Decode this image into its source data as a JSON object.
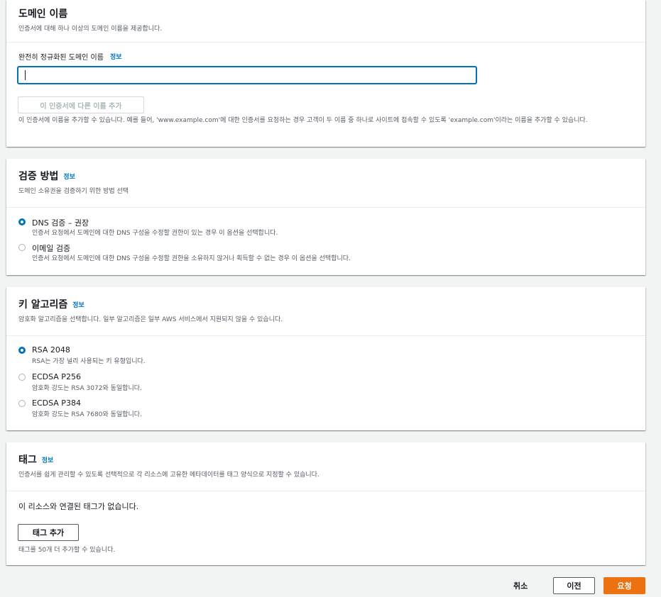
{
  "domain_panel": {
    "title": "도메인 이름",
    "description": "인증서에 대해 하나 이상의 도메인 이름을 제공합니다.",
    "field_label": "완전히 정규화된 도메인 이름",
    "info": "정보",
    "input_value": "",
    "add_name_button": "이 인증서에 다른 이름 추가",
    "hint": "이 인증서에 이름을 추가할 수 있습니다. 예를 들어, 'www.example.com'에 대한 인증서를 요청하는 경우 고객이 두 이름 중 하나로 사이트에 접속할 수 있도록 'example.com'이라는 이름을 추가할 수 있습니다."
  },
  "validation_panel": {
    "title": "검증 방법",
    "info": "정보",
    "description": "도메인 소유권을 검증하기 위한 방법 선택",
    "options": [
      {
        "label": "DNS 검증 – 권장",
        "description": "인증서 요청에서 도메인에 대한 DNS 구성을 수정할 권한이 있는 경우 이 옵션을 선택합니다.",
        "checked": true
      },
      {
        "label": "이메일 검증",
        "description": "인증서 요청에서 도메인에 대한 DNS 구성을 수정할 권한을 소유하지 않거나 획득할 수 없는 경우 이 옵션을 선택합니다.",
        "checked": false
      }
    ]
  },
  "key_panel": {
    "title": "키 알고리즘",
    "info": "정보",
    "description": "암호화 알고리즘을 선택합니다. 일부 알고리즘은 일부 AWS 서비스에서 지원되지 않을 수 있습니다.",
    "options": [
      {
        "label": "RSA 2048",
        "description": "RSA는 가장 널리 사용되는 키 유형입니다.",
        "checked": true
      },
      {
        "label": "ECDSA P256",
        "description": "암호화 강도는 RSA 3072와 동일합니다.",
        "checked": false
      },
      {
        "label": "ECDSA P384",
        "description": "암호화 강도는 RSA 7680와 동일합니다.",
        "checked": false
      }
    ]
  },
  "tag_panel": {
    "title": "태그",
    "info": "정보",
    "description": "인증서를 쉽게 관리할 수 있도록 선택적으로 각 리소스에 고유한 메타데이터를 태그 양식으로 지정할 수 있습니다.",
    "empty_text": "이 리소스와 연결된 태그가 없습니다.",
    "add_button": "태그 추가",
    "hint": "태그를 50개 더 추가할 수 있습니다."
  },
  "footer": {
    "cancel": "취소",
    "previous": "이전",
    "submit": "요청"
  },
  "colors": {
    "accent": "#0073bb",
    "primary_button": "#ec7211"
  }
}
